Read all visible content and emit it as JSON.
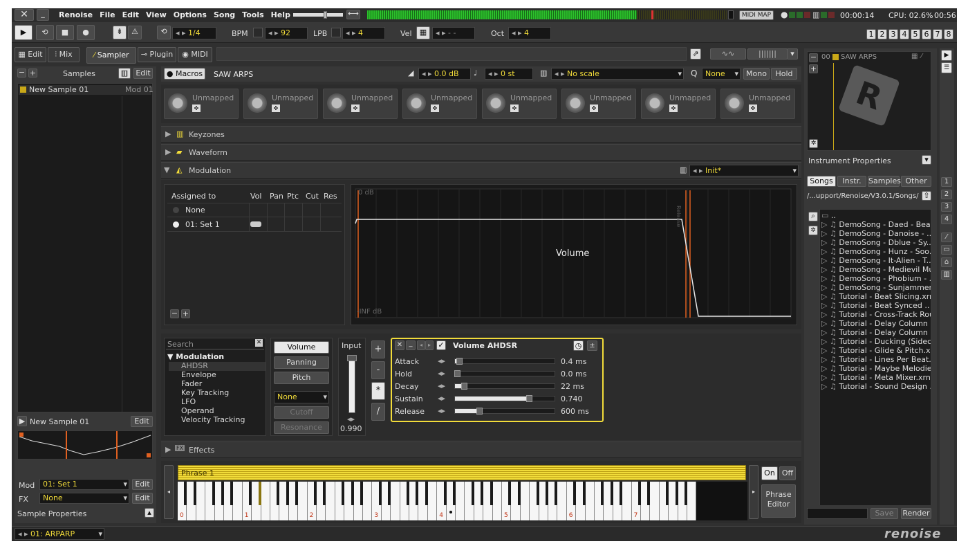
{
  "menu": {
    "items": [
      "Renoise",
      "File",
      "Edit",
      "View",
      "Options",
      "Song",
      "Tools",
      "Help"
    ],
    "midi_map": "MIDI MAP",
    "time": "00:00:14",
    "cpu": "CPU: 02.6%",
    "clock": "00:56"
  },
  "transport": {
    "lines": "1/4",
    "bpm_label": "BPM",
    "bpm": "92",
    "lpb_label": "LPB",
    "lpb": "4",
    "vel_label": "Vel",
    "vel": "- -",
    "oct_label": "Oct",
    "oct": "4",
    "tracks": [
      "1",
      "2",
      "3",
      "4",
      "5",
      "6",
      "7",
      "8"
    ]
  },
  "tabs": {
    "edit": "Edit",
    "mix": "Mix",
    "sampler": "Sampler",
    "plugin": "Plugin",
    "midi": "MIDI"
  },
  "left": {
    "samples_label": "Samples",
    "edit": "Edit",
    "sample_item": "New Sample 01",
    "sample_mod": "Mod 01",
    "preview_name": "New Sample 01",
    "preview_edit": "Edit",
    "mod_label": "Mod",
    "mod_value": "01: Set 1",
    "fx_label": "FX",
    "fx_value": "None",
    "edit2": "Edit",
    "edit3": "Edit",
    "props": "Sample Properties"
  },
  "instrument": {
    "macros": "Macros",
    "name": "SAW ARPS",
    "volume": "0.0 dB",
    "transpose": "0 st",
    "scale": "No scale",
    "q_label": "Q",
    "q": "None",
    "mono": "Mono",
    "hold": "Hold",
    "macro_label": "Unmapped"
  },
  "sections": {
    "keyzones": "Keyzones",
    "waveform": "Waveform",
    "modulation": "Modulation",
    "effects": "Effects",
    "preset": "Init*"
  },
  "mod_table": {
    "headers": [
      "Assigned to",
      "Vol",
      "Pan",
      "Ptc",
      "Cut",
      "Res"
    ],
    "rows": [
      "None",
      "01: Set 1"
    ]
  },
  "graph": {
    "db_top": "0 dB",
    "db_bottom": "-INF dB",
    "label": "Volume",
    "release_label": "Release"
  },
  "devices": {
    "search": "Search",
    "group": "Modulation",
    "items": [
      "AHDSR",
      "Envelope",
      "Fader",
      "Key Tracking",
      "LFO",
      "Operand",
      "Velocity Tracking"
    ]
  },
  "targets": {
    "volume": "Volume",
    "panning": "Panning",
    "pitch": "Pitch",
    "filter": "None",
    "cutoff": "Cutoff",
    "resonance": "Resonance",
    "input_label": "Input",
    "input_value": "0.990",
    "ops": [
      "+",
      "-",
      "*",
      "/"
    ]
  },
  "ahdsr": {
    "title": "Volume AHDSR",
    "params": [
      {
        "name": "Attack",
        "value": "0.4 ms",
        "level": 0.04
      },
      {
        "name": "Hold",
        "value": "0.0 ms",
        "level": 0.02
      },
      {
        "name": "Decay",
        "value": "22 ms",
        "level": 0.09
      },
      {
        "name": "Sustain",
        "value": "0.740",
        "level": 0.74
      },
      {
        "name": "Release",
        "value": "600 ms",
        "level": 0.24
      }
    ]
  },
  "keyboard": {
    "phrase": "Phrase 1",
    "octaves": [
      "0",
      "1",
      "2",
      "3",
      "4",
      "5",
      "6",
      "7"
    ],
    "on": "On",
    "off": "Off",
    "phrase_editor": "Phrase Editor"
  },
  "right": {
    "inst_index": "00",
    "inst_name": "SAW ARPS",
    "inst_props": "Instrument Properties",
    "tabs": [
      "Songs",
      "Instr.",
      "Samples",
      "Other"
    ],
    "path": "/...upport/Renoise/V3.0.1/Songs/",
    "files": [
      "..",
      "DemoSong - Daed - Bea..",
      "DemoSong - Danoise - ..",
      "DemoSong - Dblue - Sy..",
      "DemoSong - Hunz - Soo..",
      "DemoSong - It-Alien - T..",
      "DemoSong - Medievil Mu..",
      "DemoSong - Phobium - ..",
      "DemoSong - Sunjammer..",
      "Tutorial - Beat Slicing.xrns",
      "Tutorial - Beat Synced ..",
      "Tutorial - Cross-Track Rou..",
      "Tutorial - Delay Column ..",
      "Tutorial - Delay Column ..",
      "Tutorial - Ducking (Sidech..",
      "Tutorial - Glide & Pitch.x..",
      "Tutorial - Lines Per Beat..",
      "Tutorial - Maybe Melodie..",
      "Tutorial - Meta Mixer.xrns",
      "Tutorial - Sound Design .."
    ],
    "save": "Save",
    "render": "Render",
    "side_nums": [
      "1",
      "2",
      "3",
      "4"
    ]
  },
  "status": {
    "inst": "01: ARPARP",
    "logo": "renoise"
  }
}
